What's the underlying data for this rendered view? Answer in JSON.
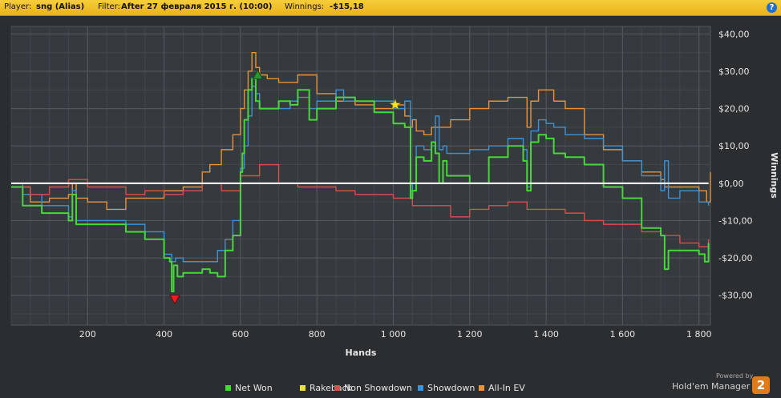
{
  "header": {
    "player_label": "Player:",
    "player_value": "sng (Alias)",
    "filter_label": "Filter:",
    "filter_value": "After 27 февраля 2015 г. (10:00)",
    "winnings_label": "Winnings:",
    "winnings_value": "-$15,18",
    "help": "?"
  },
  "brand": {
    "powered": "Powered by",
    "name": "Hold'em Manager",
    "badge": "2"
  },
  "chart_data": {
    "type": "line",
    "xlabel": "Hands",
    "ylabel": "Winnings",
    "xlim": [
      0,
      1830
    ],
    "ylim": [
      -38,
      42
    ],
    "x_ticks": [
      200,
      400,
      600,
      800,
      1000,
      1200,
      1400,
      1600,
      1800
    ],
    "x_tick_labels": [
      "200",
      "400",
      "600",
      "800",
      "1 000",
      "1 200",
      "1 400",
      "1 600",
      "1 800"
    ],
    "y_ticks": [
      -30,
      -20,
      -10,
      0,
      10,
      20,
      30,
      40
    ],
    "y_tick_labels": [
      "-$30,00",
      "-$20,00",
      "-$10,00",
      "$0,00",
      "$10,00",
      "$20,00",
      "$30,00",
      "$40,00"
    ],
    "grid": true,
    "legend": "bottom",
    "series": [
      {
        "name": "Net Won",
        "color": "#49d63d",
        "x": [
          0,
          30,
          80,
          150,
          160,
          170,
          200,
          300,
          350,
          400,
          415,
          420,
          425,
          435,
          450,
          500,
          520,
          540,
          560,
          580,
          600,
          605,
          610,
          620,
          630,
          640,
          650,
          700,
          730,
          750,
          780,
          800,
          850,
          900,
          950,
          1000,
          1030,
          1045,
          1050,
          1060,
          1080,
          1100,
          1110,
          1120,
          1130,
          1140,
          1200,
          1250,
          1300,
          1340,
          1350,
          1360,
          1380,
          1400,
          1420,
          1450,
          1500,
          1550,
          1600,
          1650,
          1700,
          1710,
          1720,
          1750,
          1800,
          1815,
          1825
        ],
        "y": [
          -1,
          -6,
          -8,
          -10,
          -3,
          -11,
          -11,
          -13,
          -15,
          -20,
          -21,
          -29,
          -22,
          -25,
          -24,
          -23,
          -24,
          -25,
          -18,
          -14,
          3,
          8,
          17,
          25,
          28,
          22,
          20,
          22,
          21,
          25,
          17,
          20,
          23,
          22,
          19,
          16,
          15,
          -4,
          -2,
          7,
          6,
          11,
          8,
          0,
          6,
          2,
          0,
          7,
          10,
          6,
          -2,
          11,
          13,
          12,
          8,
          7,
          5,
          -1,
          -4,
          -12,
          -14,
          -23,
          -18,
          -18,
          -19,
          -21,
          -16
        ]
      },
      {
        "name": "Showdown",
        "color": "#3f91d4",
        "x": [
          0,
          30,
          80,
          150,
          160,
          170,
          200,
          300,
          350,
          400,
          420,
          430,
          450,
          500,
          520,
          540,
          560,
          580,
          600,
          610,
          620,
          630,
          640,
          650,
          700,
          730,
          750,
          780,
          800,
          850,
          870,
          900,
          950,
          1000,
          1030,
          1045,
          1050,
          1060,
          1080,
          1100,
          1110,
          1120,
          1130,
          1140,
          1200,
          1250,
          1300,
          1340,
          1350,
          1360,
          1380,
          1400,
          1420,
          1450,
          1500,
          1550,
          1600,
          1650,
          1700,
          1710,
          1720,
          1750,
          1800,
          1825
        ],
        "y": [
          0,
          -3,
          -6,
          -9,
          -2,
          -10,
          -10,
          -11,
          -13,
          -19,
          -21,
          -20,
          -21,
          -21,
          -21,
          -18,
          -15,
          -10,
          4,
          10,
          18,
          26,
          24,
          20,
          20,
          22,
          23,
          20,
          22,
          25,
          22,
          22,
          22,
          20,
          22,
          -2,
          0,
          10,
          9,
          10,
          18,
          9,
          10,
          8,
          9,
          10,
          12,
          9,
          -1,
          14,
          17,
          16,
          15,
          13,
          12,
          10,
          6,
          2,
          -2,
          6,
          -4,
          -2,
          -5,
          -6
        ]
      },
      {
        "name": "Non Showdown",
        "color": "#d6504d",
        "x": [
          0,
          50,
          100,
          150,
          200,
          250,
          300,
          350,
          400,
          450,
          500,
          550,
          600,
          650,
          700,
          750,
          800,
          850,
          900,
          950,
          1000,
          1050,
          1100,
          1150,
          1200,
          1250,
          1300,
          1350,
          1400,
          1450,
          1500,
          1550,
          1600,
          1650,
          1700,
          1750,
          1800,
          1825
        ],
        "y": [
          -1,
          -3,
          -1,
          1,
          -1,
          -1,
          -3,
          -2,
          -3,
          -2,
          0,
          -2,
          2,
          5,
          0,
          -1,
          -1,
          -2,
          -3,
          -3,
          -4,
          -6,
          -6,
          -9,
          -7,
          -6,
          -5,
          -7,
          -7,
          -8,
          -10,
          -11,
          -11,
          -13,
          -14,
          -16,
          -17,
          -15
        ]
      },
      {
        "name": "All-In EV",
        "color": "#e8923c",
        "x": [
          0,
          50,
          100,
          150,
          160,
          170,
          200,
          250,
          300,
          350,
          400,
          450,
          500,
          520,
          550,
          580,
          600,
          610,
          620,
          630,
          640,
          650,
          670,
          700,
          750,
          800,
          850,
          900,
          950,
          1000,
          1030,
          1045,
          1050,
          1060,
          1080,
          1100,
          1150,
          1200,
          1250,
          1300,
          1350,
          1360,
          1380,
          1400,
          1420,
          1450,
          1500,
          1550,
          1600,
          1650,
          1700,
          1710,
          1750,
          1800,
          1820,
          1830
        ],
        "y": [
          -1,
          -5,
          -4,
          -3,
          0,
          -4,
          -5,
          -7,
          -4,
          -4,
          -2,
          -1,
          3,
          5,
          9,
          13,
          20,
          25,
          30,
          35,
          31,
          29,
          28,
          27,
          29,
          24,
          22,
          21,
          20,
          21,
          18,
          15,
          17,
          14,
          13,
          15,
          17,
          20,
          22,
          23,
          15,
          22,
          25,
          25,
          22,
          20,
          13,
          9,
          6,
          3,
          1,
          -1,
          -1,
          -2,
          -5,
          3
        ]
      },
      {
        "name": "Rakeback",
        "color": "#e8e04a",
        "x": [
          0,
          1825
        ],
        "y": [
          0,
          0
        ]
      }
    ],
    "markers": [
      {
        "type": "max",
        "x": 645,
        "y": 29,
        "color": "#1e9b2c"
      },
      {
        "type": "min",
        "x": 428,
        "y": -31,
        "color": "#e82020"
      },
      {
        "type": "star",
        "x": 1005,
        "y": 21,
        "color": "#f4e21a"
      }
    ]
  }
}
